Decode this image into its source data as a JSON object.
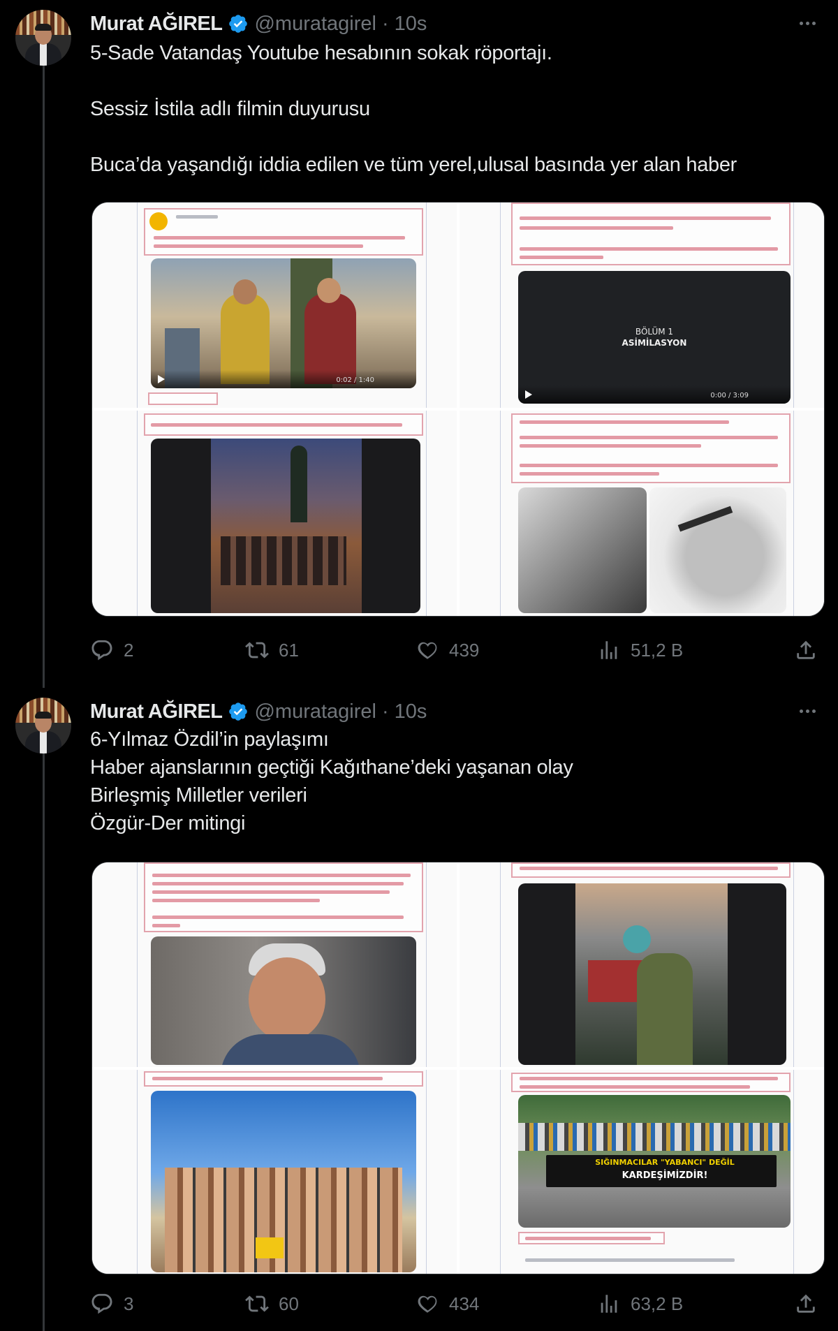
{
  "tweets": [
    {
      "author": {
        "name": "Murat AĞIREL",
        "handle": "@muratagirel",
        "time": "10s"
      },
      "lines": [
        "5-Sade Vatandaş Youtube hesabının sokak röportajı.",
        "",
        "Sessiz İstila adlı filmin duyurusu",
        "",
        "Buca’da yaşandığı iddia edilen ve tüm yerel,ulusal basında yer alan haber"
      ],
      "media_text": {
        "video_title_line1": "BÖLÜM 1",
        "video_title_line2": "ASİMİLASYON",
        "video_time_a": "0:02 / 1:40",
        "video_time_b": "0:00 / 3:09"
      },
      "actions": {
        "replies": "2",
        "retweets": "61",
        "likes": "439",
        "views": "51,2 B"
      }
    },
    {
      "author": {
        "name": "Murat AĞIREL",
        "handle": "@muratagirel",
        "time": "10s"
      },
      "lines": [
        "6-Yılmaz Özdil’in paylaşımı",
        "Haber ajanslarının geçtiği Kağıthane’deki yaşanan olay",
        "Birleşmiş Milletler verileri",
        "Özgür-Der mitingi"
      ],
      "media_text": {
        "banner_line1": "SIĞINMACILAR \"YABANCI\" DEĞİL",
        "banner_line2": "KARDEŞİMİZDİR!"
      },
      "actions": {
        "replies": "3",
        "retweets": "60",
        "likes": "434",
        "views": "63,2 B"
      }
    }
  ],
  "colors": {
    "background": "#000000",
    "text": "#e7e9ea",
    "muted": "#71767b",
    "verified": "#1d9bf0",
    "thread_line": "#333639"
  },
  "icons": [
    "more-icon",
    "verified-badge-icon",
    "reply-icon",
    "retweet-icon",
    "like-icon",
    "views-icon",
    "share-icon"
  ]
}
